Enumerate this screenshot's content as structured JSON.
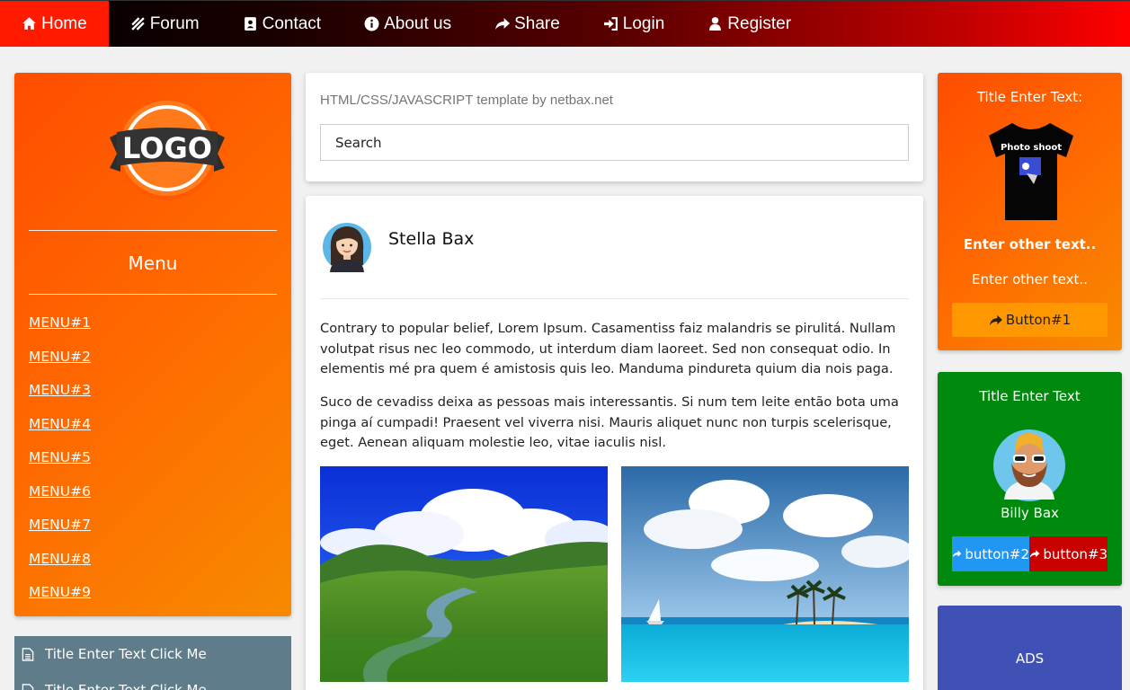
{
  "nav": {
    "items": [
      {
        "label": "Home",
        "icon": "home-icon"
      },
      {
        "label": "Forum",
        "icon": "feed-icon"
      },
      {
        "label": "Contact",
        "icon": "address-book-icon"
      },
      {
        "label": "About us",
        "icon": "info-icon"
      },
      {
        "label": "Share",
        "icon": "share-icon"
      },
      {
        "label": "Login",
        "icon": "sign-in-icon"
      },
      {
        "label": "Register",
        "icon": "user-icon"
      }
    ],
    "colors": {
      "start": "#000000",
      "end": "#ff0000",
      "active": "#ff1a00"
    }
  },
  "sidebar": {
    "logo_text": "LOGO",
    "menu_title": "Menu",
    "menu_items": [
      "MENU#1",
      "MENU#2",
      "MENU#3",
      "MENU#4",
      "MENU#5",
      "MENU#6",
      "MENU#7",
      "MENU#8",
      "MENU#9"
    ],
    "accordion": [
      "Title Enter Text Click Me",
      "Title Enter Text Click Me"
    ],
    "color": "#ff6a00"
  },
  "main": {
    "template_text": "HTML/CSS/JAVASCRIPT template by netbax.net",
    "search_placeholder": "Search",
    "post": {
      "author": "Stella Bax",
      "paragraphs": [
        "Contrary to popular belief, Lorem Ipsum. Casamentiss faiz malandris se pirulitá. Nullam volutpat risus nec leo commodo, ut interdum diam laoreet. Sed non consequat odio. In elementis mé pra quem é amistosis quis leo. Manduma pindureta quium dia nois paga.",
        "Suco de cevadiss deixa as pessoas mais interessantis. Si num tem leite então bota uma pinga aí cumpadi! Praesent vel viverra nisi. Mauris aliquet nunc non turpis scelerisque, eget. Aenean aliquam molestie leo, vitae iaculis nisl."
      ]
    }
  },
  "right": {
    "card1": {
      "title": "Title Enter Text:",
      "tshirt_text": "Photo shoot",
      "bold_text": "Enter other text..",
      "text": "Enter other text..",
      "button": "Button#1",
      "button_color": "#ff9800"
    },
    "card2": {
      "title": "Title Enter Text",
      "name": "Billy Bax",
      "button2": "button#2",
      "button3": "button#3",
      "color": "#008a0d"
    },
    "card3": {
      "label": "ADS",
      "color": "#3f51b5"
    }
  }
}
